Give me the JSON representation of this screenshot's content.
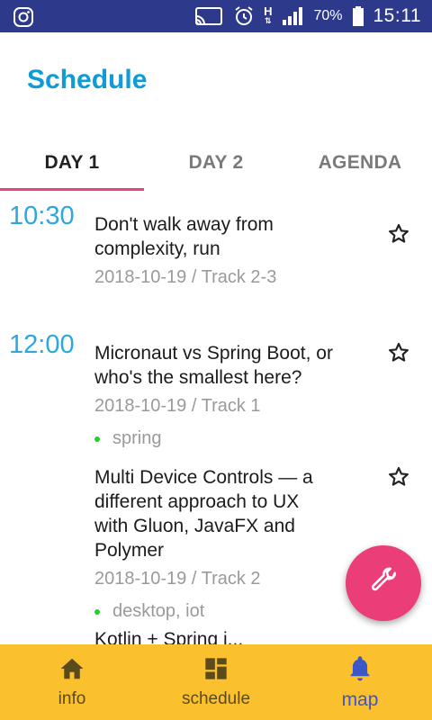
{
  "status_bar": {
    "battery": "70%",
    "time": "15:11",
    "network": "H",
    "icons": [
      "instagram-icon",
      "cast-icon",
      "alarm-icon",
      "signal-icon",
      "battery-icon"
    ]
  },
  "app": {
    "title": "Schedule"
  },
  "tabs": [
    {
      "label": "DAY 1",
      "active": true
    },
    {
      "label": "DAY 2",
      "active": false
    },
    {
      "label": "AGENDA",
      "active": false
    }
  ],
  "schedule": {
    "slots": [
      {
        "time": "10:30",
        "sessions": [
          {
            "title_lines": [
              "Don't walk away from",
              "complexity, run"
            ],
            "meta": "2018-10-19 / Track 2-3",
            "tags": ""
          }
        ]
      },
      {
        "time": "12:00",
        "sessions": [
          {
            "title_lines": [
              "Micronaut vs Spring Boot, or",
              "who's the smallest here?"
            ],
            "meta": "2018-10-19 / Track 1",
            "tags": "spring"
          },
          {
            "title_lines": [
              "Multi Device Controls — a",
              "different approach to UX",
              "with Gluon, JavaFX and",
              "Polymer"
            ],
            "meta": "2018-10-19 / Track 2",
            "tags": "desktop, iot"
          },
          {
            "title_lines": [
              "Kotlin + Spring i..."
            ],
            "meta": "",
            "tags": ""
          }
        ]
      }
    ]
  },
  "fab": {
    "icon": "wrench-icon"
  },
  "bottom_nav": {
    "items": [
      {
        "label": "info",
        "icon": "home-icon",
        "active": false
      },
      {
        "label": "schedule",
        "icon": "dashboard-icon",
        "active": false
      },
      {
        "label": "map",
        "icon": "bell-icon",
        "active": true
      }
    ]
  },
  "colors": {
    "status_bar": "#2d3a8c",
    "title": "#0e9bd8",
    "tab_indicator": "#e94482",
    "time": "#2ea6de",
    "fab": "#eb3e78",
    "bottom_nav": "#fbc02d",
    "nav_active": "#3d56c9",
    "tag_dot": "#1fd12b"
  }
}
